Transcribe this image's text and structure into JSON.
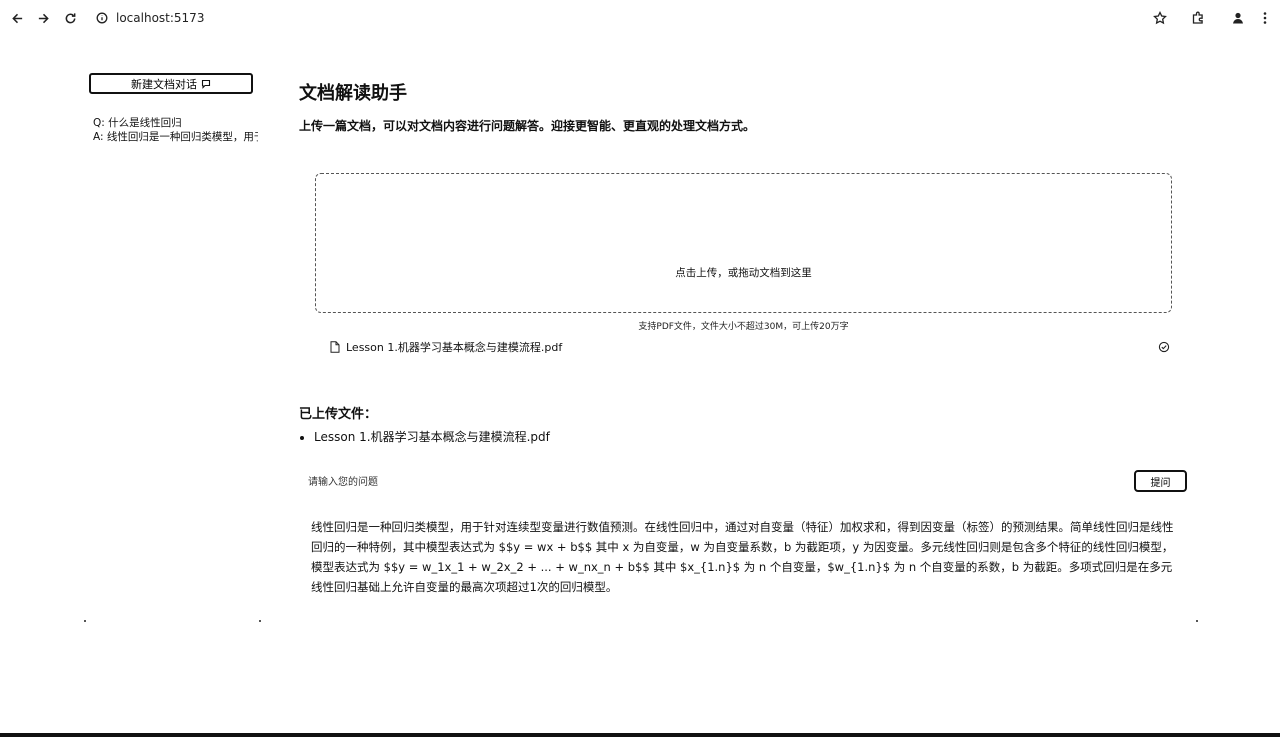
{
  "browser": {
    "url": "localhost:5173"
  },
  "sidebar": {
    "new_session_label": "新建文档对话",
    "history": [
      {
        "question": "Q: 什么是线性回归",
        "answer": "A: 线性回归是一种回归类模型，用于针对连续型变量进行数值预测"
      }
    ]
  },
  "main": {
    "title": "文档解读助手",
    "subtitle": "上传一篇文档，可以对文档内容进行问题解答。迎接更智能、更直观的处理文档方式。",
    "upload": {
      "prompt": "点击上传，或拖动文档到这里",
      "hint": "支持PDF文件，文件大小不超过30M，可上传20万字",
      "file_name": "Lesson 1.机器学习基本概念与建模流程.pdf"
    },
    "uploaded_heading": "已上传文件：",
    "uploaded_files": [
      "Lesson 1.机器学习基本概念与建模流程.pdf"
    ],
    "question_placeholder": "请输入您的问题",
    "submit_label": "提问",
    "answer": "线性回归是一种回归类模型，用于针对连续型变量进行数值预测。在线性回归中，通过对自变量（特征）加权求和，得到因变量（标签）的预测结果。简单线性回归是线性回归的一种特例，其中模型表达式为 $$y = wx + b$$ 其中 x 为自变量，w 为自变量系数，b 为截距项，y 为因变量。多元线性回归则是包含多个特征的线性回归模型，模型表达式为 $$y = w_1x_1 + w_2x_2 + ... + w_nx_n + b$$ 其中 $x_{1.n}$ 为 n 个自变量，$w_{1.n}$ 为 n 个自变量的系数，b 为截距。多项式回归是在多元线性回归基础上允许自变量的最高次项超过1次的回归模型。"
  },
  "icons": [
    "back-arrow-icon",
    "forward-arrow-icon",
    "reload-icon",
    "site-info-icon",
    "star-icon",
    "extensions-icon",
    "profile-icon",
    "more-menu-icon",
    "document-icon",
    "check-circle-icon"
  ]
}
